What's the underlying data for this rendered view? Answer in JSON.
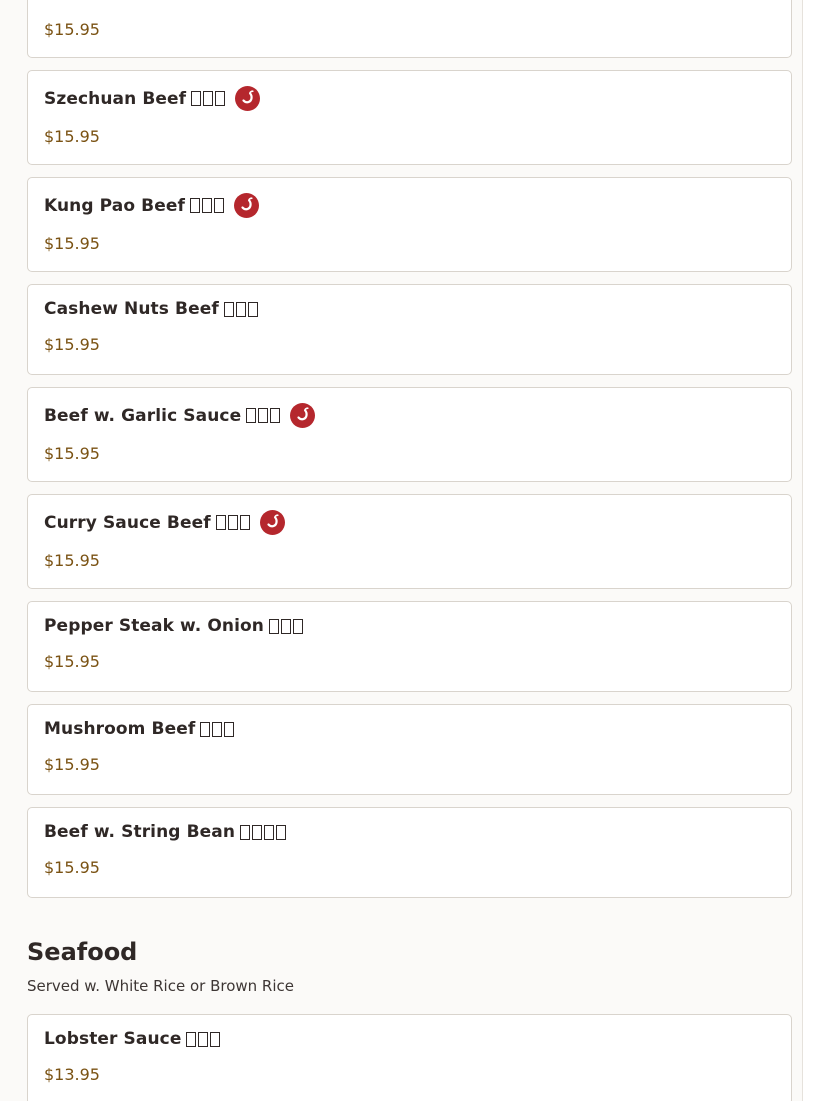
{
  "top_item": {
    "price": "$15.95"
  },
  "beef_items": [
    {
      "name": "Szechuan Beef",
      "spicy": true,
      "price": "$15.95"
    },
    {
      "name": "Kung Pao Beef",
      "spicy": true,
      "price": "$15.95"
    },
    {
      "name": "Cashew Nuts Beef",
      "spicy": false,
      "price": "$15.95"
    },
    {
      "name": "Beef w. Garlic Sauce",
      "spicy": true,
      "price": "$15.95"
    },
    {
      "name": "Curry Sauce Beef",
      "spicy": true,
      "price": "$15.95"
    },
    {
      "name": "Pepper Steak w. Onion",
      "spicy": false,
      "price": "$15.95"
    },
    {
      "name": "Mushroom Beef",
      "spicy": false,
      "price": "$15.95"
    },
    {
      "name": "Beef w. String Bean",
      "spicy": false,
      "price": "$15.95"
    }
  ],
  "seafood": {
    "title": "Seafood",
    "description": "Served w. White Rice or Brown Rice",
    "items": [
      {
        "name": "Lobster Sauce",
        "spicy": false,
        "price": "$13.95"
      }
    ]
  },
  "icons": {
    "spicy": "chili-pepper-icon"
  },
  "colors": {
    "price": "#7a5213",
    "spicy_badge": "#b5272d",
    "heading": "#2f2826"
  }
}
